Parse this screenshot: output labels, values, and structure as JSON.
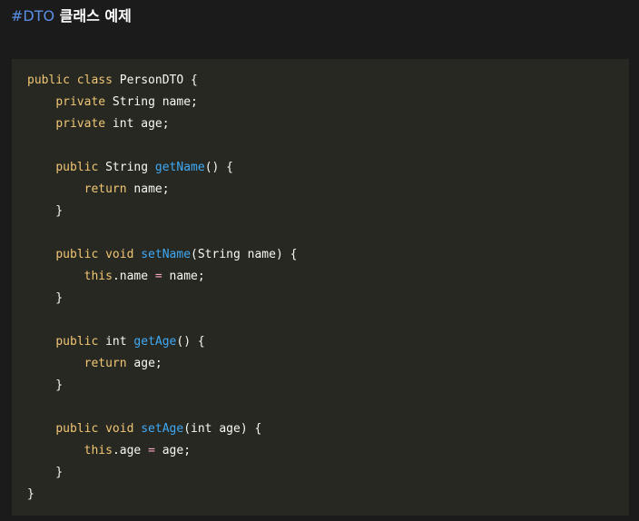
{
  "heading": {
    "tag": "#DTO",
    "title": "클래스 예제"
  },
  "colors": {
    "background": "#1b1b1b",
    "code_background": "#272822",
    "keyword": "#f0c674",
    "function": "#3fa9f5",
    "operator": "#f8a6c4",
    "text": "#f8f8f2",
    "tag": "#5a8fe6"
  },
  "code": {
    "language": "java",
    "lines": [
      [
        {
          "t": "public class",
          "k": "kw"
        },
        {
          "t": " PersonDTO {",
          "k": "tx"
        }
      ],
      [
        {
          "t": "    ",
          "k": "tx"
        },
        {
          "t": "private",
          "k": "kw"
        },
        {
          "t": " String name;",
          "k": "tx"
        }
      ],
      [
        {
          "t": "    ",
          "k": "tx"
        },
        {
          "t": "private",
          "k": "kw"
        },
        {
          "t": " int age;",
          "k": "tx"
        }
      ],
      [],
      [
        {
          "t": "    ",
          "k": "tx"
        },
        {
          "t": "public",
          "k": "kw"
        },
        {
          "t": " String ",
          "k": "tx"
        },
        {
          "t": "getName",
          "k": "fn"
        },
        {
          "t": "() {",
          "k": "tx"
        }
      ],
      [
        {
          "t": "        ",
          "k": "tx"
        },
        {
          "t": "return",
          "k": "kw"
        },
        {
          "t": " name;",
          "k": "tx"
        }
      ],
      [
        {
          "t": "    }",
          "k": "tx"
        }
      ],
      [],
      [
        {
          "t": "    ",
          "k": "tx"
        },
        {
          "t": "public void",
          "k": "kw"
        },
        {
          "t": " ",
          "k": "tx"
        },
        {
          "t": "setName",
          "k": "fn"
        },
        {
          "t": "(String name) {",
          "k": "tx"
        }
      ],
      [
        {
          "t": "        ",
          "k": "tx"
        },
        {
          "t": "this",
          "k": "kw"
        },
        {
          "t": ".name ",
          "k": "tx"
        },
        {
          "t": "=",
          "k": "op"
        },
        {
          "t": " name;",
          "k": "tx"
        }
      ],
      [
        {
          "t": "    }",
          "k": "tx"
        }
      ],
      [],
      [
        {
          "t": "    ",
          "k": "tx"
        },
        {
          "t": "public",
          "k": "kw"
        },
        {
          "t": " int ",
          "k": "tx"
        },
        {
          "t": "getAge",
          "k": "fn"
        },
        {
          "t": "() {",
          "k": "tx"
        }
      ],
      [
        {
          "t": "        ",
          "k": "tx"
        },
        {
          "t": "return",
          "k": "kw"
        },
        {
          "t": " age;",
          "k": "tx"
        }
      ],
      [
        {
          "t": "    }",
          "k": "tx"
        }
      ],
      [],
      [
        {
          "t": "    ",
          "k": "tx"
        },
        {
          "t": "public void",
          "k": "kw"
        },
        {
          "t": " ",
          "k": "tx"
        },
        {
          "t": "setAge",
          "k": "fn"
        },
        {
          "t": "(int age) {",
          "k": "tx"
        }
      ],
      [
        {
          "t": "        ",
          "k": "tx"
        },
        {
          "t": "this",
          "k": "kw"
        },
        {
          "t": ".age ",
          "k": "tx"
        },
        {
          "t": "=",
          "k": "op"
        },
        {
          "t": " age;",
          "k": "tx"
        }
      ],
      [
        {
          "t": "    }",
          "k": "tx"
        }
      ],
      [
        {
          "t": "}",
          "k": "tx"
        }
      ]
    ]
  }
}
